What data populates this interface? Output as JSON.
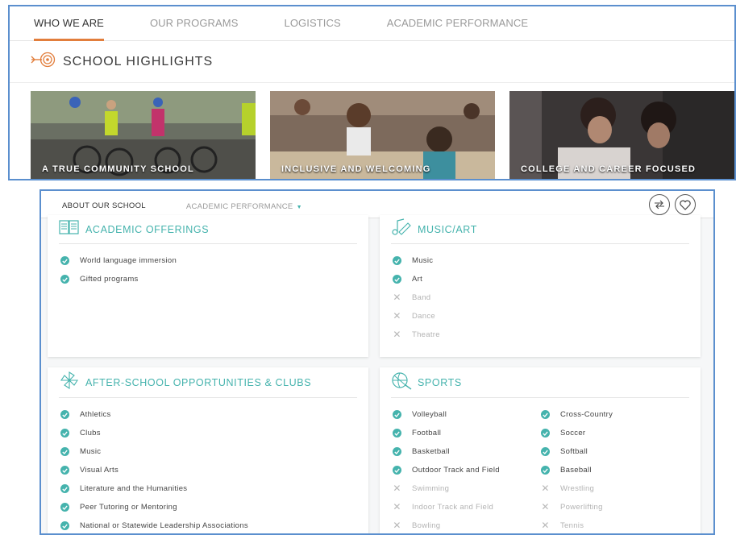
{
  "top": {
    "tabs": [
      "WHO WE ARE",
      "OUR PROGRAMS",
      "LOGISTICS",
      "ACADEMIC PERFORMANCE"
    ],
    "active_tab": 0,
    "section_title": "SCHOOL HIGHLIGHTS",
    "tiles": [
      {
        "label": "A TRUE COMMUNITY SCHOOL"
      },
      {
        "label": "INCLUSIVE AND WELCOMING"
      },
      {
        "label": "COLLEGE AND CAREER FOCUSED"
      }
    ]
  },
  "bottom": {
    "nav": {
      "about": "ABOUT OUR SCHOOL",
      "academic": "ACADEMIC PERFORMANCE",
      "caret": "▼"
    },
    "academic_offerings": {
      "title": "ACADEMIC OFFERINGS",
      "items": [
        {
          "label": "World language immersion",
          "on": true
        },
        {
          "label": "Gifted programs",
          "on": true
        }
      ]
    },
    "music_art": {
      "title": "MUSIC/ART",
      "items": [
        {
          "label": "Music",
          "on": true
        },
        {
          "label": "Art",
          "on": true
        },
        {
          "label": "Band",
          "on": false
        },
        {
          "label": "Dance",
          "on": false
        },
        {
          "label": "Theatre",
          "on": false
        }
      ]
    },
    "after_school": {
      "title": "AFTER-SCHOOL OPPORTUNITIES & CLUBS",
      "items": [
        {
          "label": "Athletics",
          "on": true
        },
        {
          "label": "Clubs",
          "on": true
        },
        {
          "label": "Music",
          "on": true
        },
        {
          "label": "Visual Arts",
          "on": true
        },
        {
          "label": "Literature and the Humanities",
          "on": true
        },
        {
          "label": "Peer Tutoring or Mentoring",
          "on": true
        },
        {
          "label": "National or Statewide Leadership Associations",
          "on": true
        }
      ]
    },
    "sports": {
      "title": "SPORTS",
      "items": [
        {
          "label": "Volleyball",
          "on": true
        },
        {
          "label": "Cross-Country",
          "on": true
        },
        {
          "label": "Football",
          "on": true
        },
        {
          "label": "Soccer",
          "on": true
        },
        {
          "label": "Basketball",
          "on": true
        },
        {
          "label": "Softball",
          "on": true
        },
        {
          "label": "Outdoor Track and Field",
          "on": true
        },
        {
          "label": "Baseball",
          "on": true
        },
        {
          "label": "Swimming",
          "on": false
        },
        {
          "label": "Wrestling",
          "on": false
        },
        {
          "label": "Indoor Track and Field",
          "on": false
        },
        {
          "label": "Powerlifting",
          "on": false
        },
        {
          "label": "Bowling",
          "on": false
        },
        {
          "label": "Tennis",
          "on": false
        }
      ]
    }
  },
  "colors": {
    "accent_orange": "#e27e3c",
    "accent_teal": "#45b3ad",
    "frame_blue": "#5b8fce"
  }
}
